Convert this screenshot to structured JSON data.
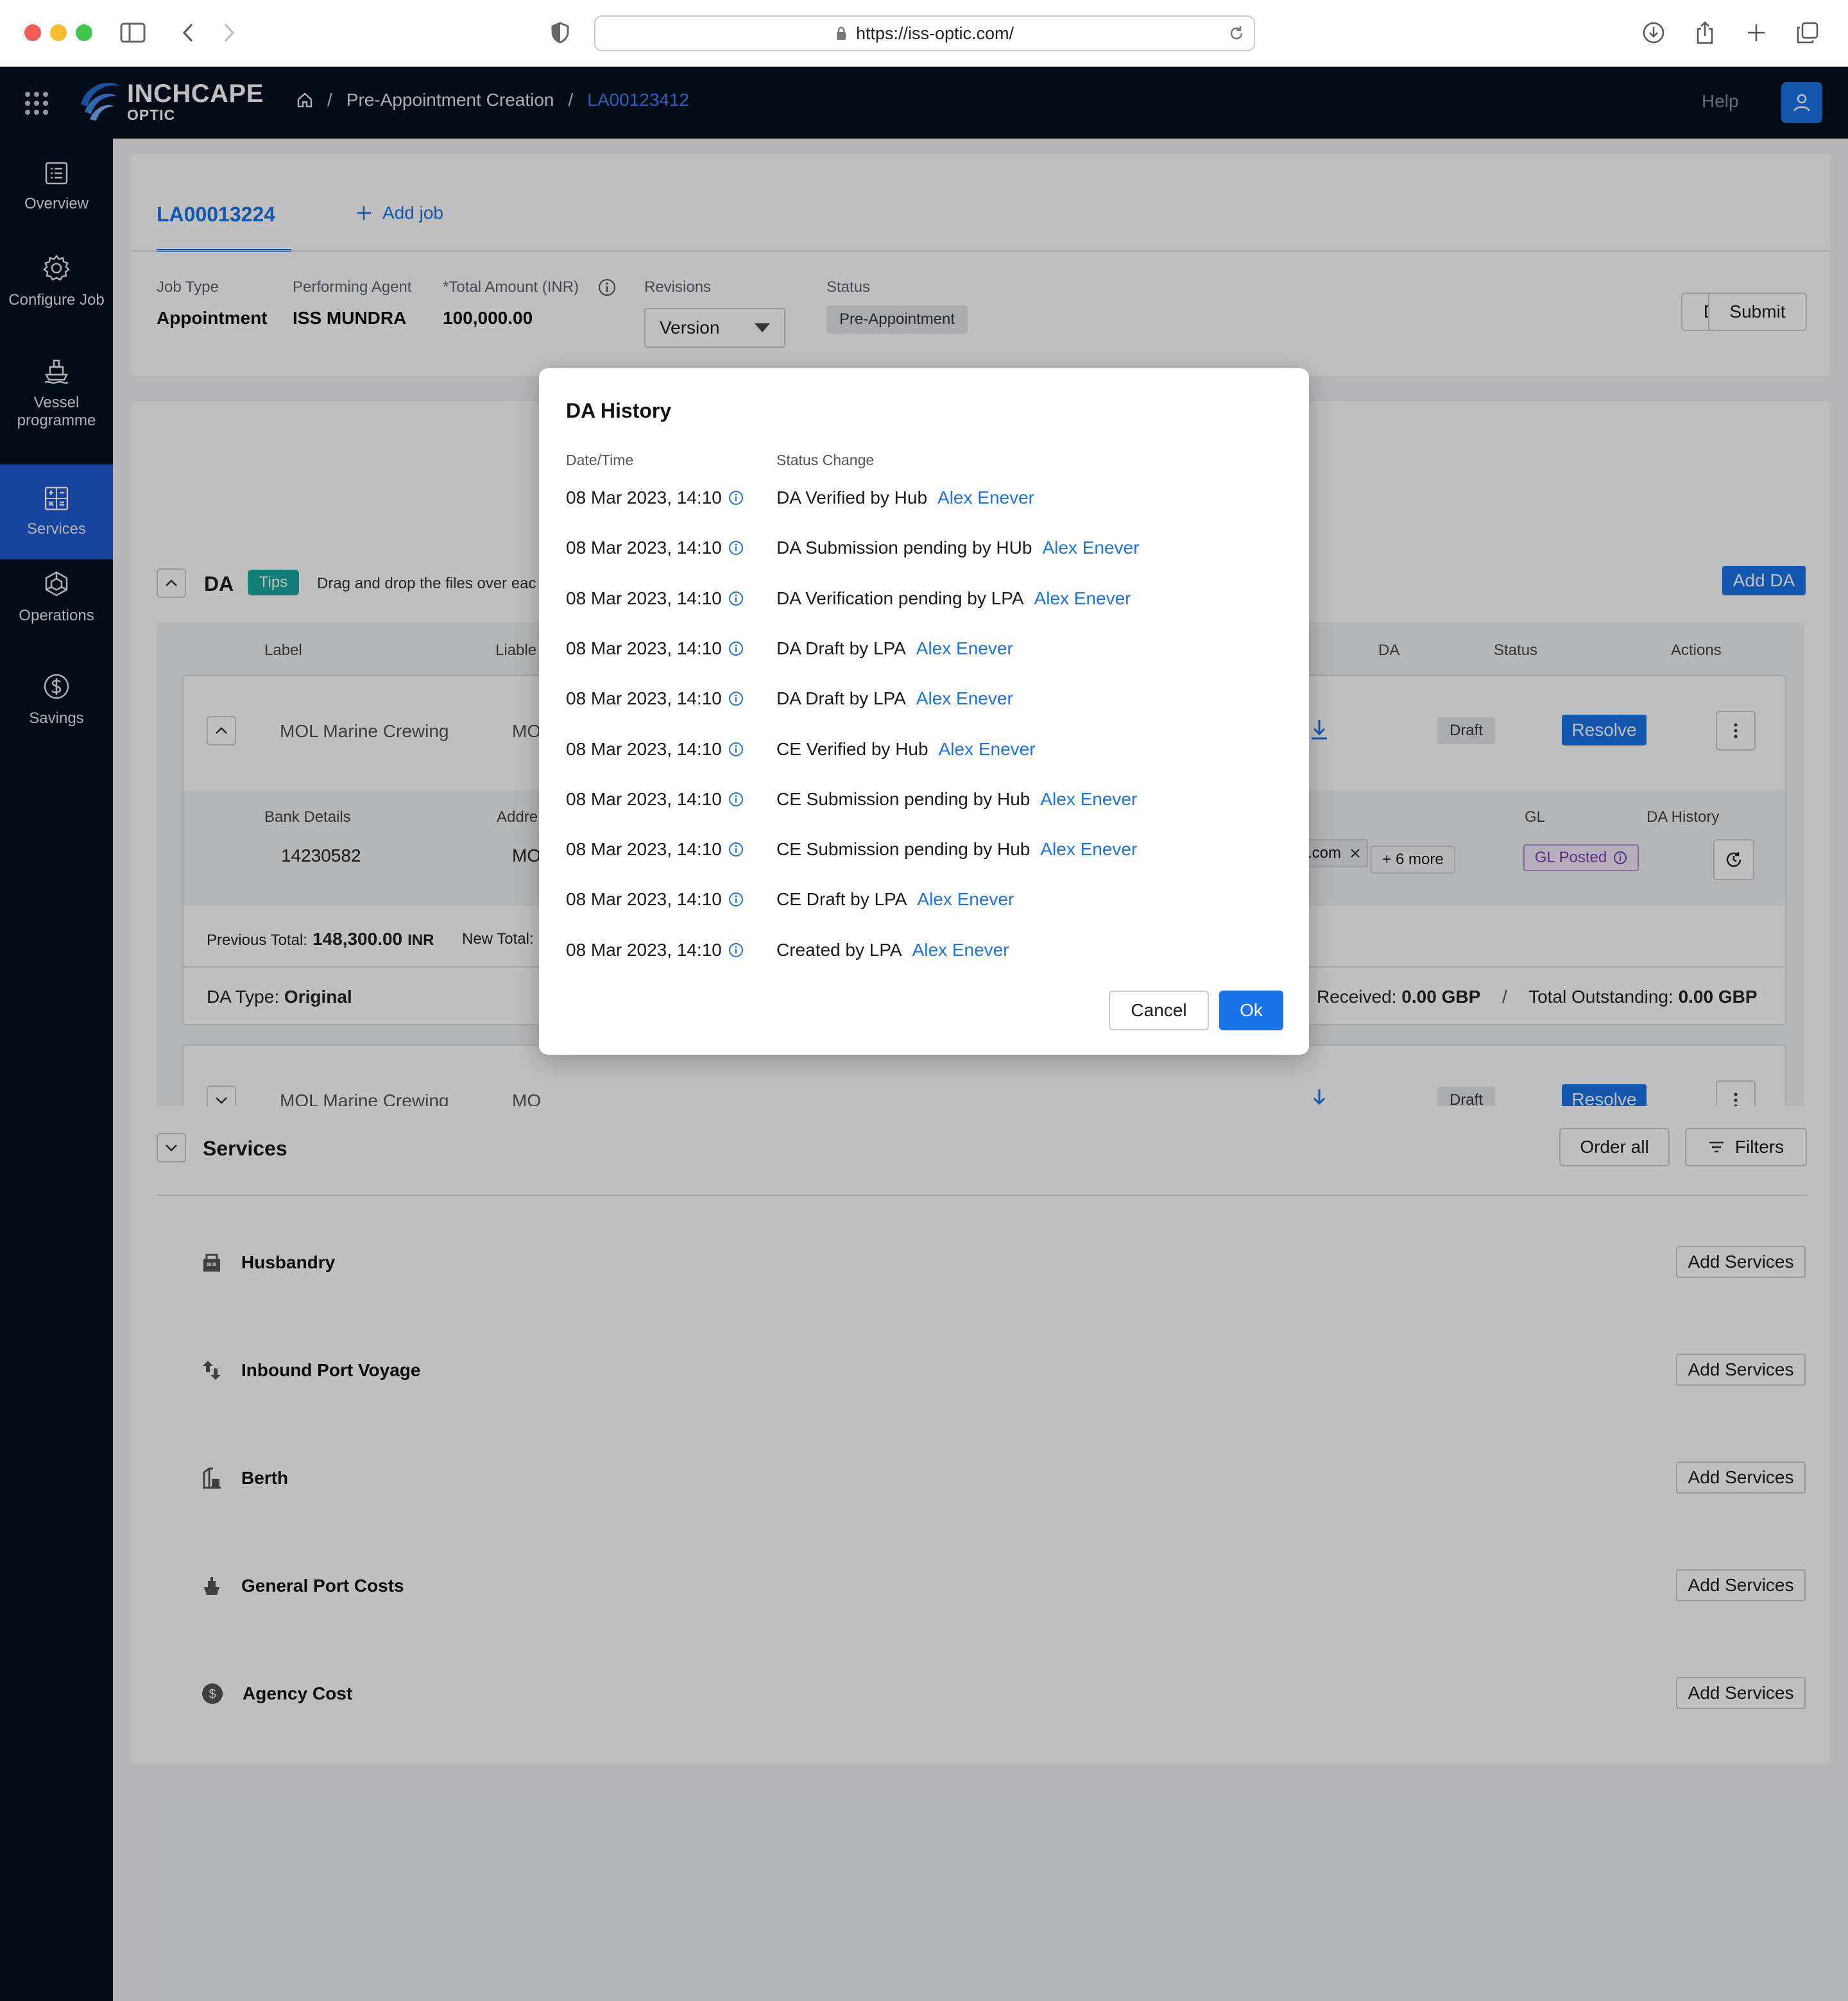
{
  "browser": {
    "url": "https://iss-optic.com/"
  },
  "topbar": {
    "brand_name": "INCHCAPE",
    "brand_sub": "OPTIC",
    "breadcrumb": [
      "Pre-Appointment Creation",
      "LA00123412"
    ],
    "help_label": "Help"
  },
  "sidebar": {
    "items": [
      {
        "label": "Overview",
        "icon": "overview-icon"
      },
      {
        "label": "Configure Job",
        "icon": "gear-icon"
      },
      {
        "label": "Vessel programme",
        "icon": "ship-icon"
      },
      {
        "label": "Services",
        "icon": "calculator-icon",
        "active": true
      },
      {
        "label": "Operations",
        "icon": "operations-icon"
      },
      {
        "label": "Savings",
        "icon": "dollar-icon"
      }
    ]
  },
  "job": {
    "tab_label": "LA00013224",
    "add_job_label": "Add job",
    "fields": {
      "job_type_label": "Job Type",
      "job_type_value": "Appointment",
      "agent_label": "Performing Agent",
      "agent_value": "ISS MUNDRA",
      "amount_label": "*Total Amount (INR)",
      "amount_value": "100,000.00",
      "revisions_label": "Revisions",
      "revisions_value": "Version",
      "status_label": "Status",
      "status_value": "Pre-Appointment"
    },
    "download_label": "Download",
    "submit_label": "Submit"
  },
  "da": {
    "title": "DA",
    "tips_label": "Tips",
    "tips_text": "Drag and drop the files over eac",
    "add_da_label": "Add DA",
    "columns": {
      "label": "Label",
      "liable": "Liable",
      "da": "DA",
      "status": "Status",
      "actions": "Actions"
    },
    "row1": {
      "label": "MOL Marine Crewing",
      "liable": "MO",
      "status": "Draft",
      "resolve_label": "Resolve",
      "bank_details_label": "Bank Details",
      "bank_details_value": "14230582",
      "address_label": "Addre",
      "address_value": "MO",
      "email_tag": ".com",
      "more_label": "+ 6 more",
      "gl_label": "GL",
      "gl_value": "GL Posted",
      "da_history_label": "DA History",
      "previous_total_label": "Previous Total:",
      "previous_total_value": "148,300.00",
      "previous_total_currency": "INR",
      "new_total_label": "New Total:",
      "da_type_label": "DA Type:",
      "da_type_value": "Original",
      "received_label": "Received:",
      "received_value": "0.00 GBP",
      "outstanding_label": "Total Outstanding:",
      "outstanding_value": "0.00 GBP"
    },
    "row2": {
      "label": "MOL Marine Crewing",
      "liable": "MO",
      "status": "Draft",
      "resolve_label": "Resolve"
    }
  },
  "services": {
    "title": "Services",
    "order_all_label": "Order all",
    "filters_label": "Filters",
    "add_services_label": "Add Services",
    "items": [
      {
        "name": "Husbandry",
        "icon": "husbandry-icon"
      },
      {
        "name": "Inbound Port Voyage",
        "icon": "voyage-icon"
      },
      {
        "name": "Berth",
        "icon": "berth-icon"
      },
      {
        "name": "General Port Costs",
        "icon": "port-costs-icon"
      },
      {
        "name": "Agency Cost",
        "icon": "agency-cost-icon"
      }
    ]
  },
  "modal": {
    "title": "DA History",
    "col_datetime": "Date/Time",
    "col_status": "Status Change",
    "rows": [
      {
        "datetime": "08 Mar 2023, 14:10",
        "status": "DA Verified by Hub",
        "user": "Alex Enever"
      },
      {
        "datetime": "08 Mar 2023, 14:10",
        "status": "DA Submission pending by HUb",
        "user": "Alex Enever"
      },
      {
        "datetime": "08 Mar 2023, 14:10",
        "status": "DA Verification pending by LPA",
        "user": "Alex Enever"
      },
      {
        "datetime": "08 Mar 2023, 14:10",
        "status": "DA Draft by LPA",
        "user": "Alex Enever"
      },
      {
        "datetime": "08 Mar 2023, 14:10",
        "status": "DA Draft by LPA",
        "user": "Alex Enever"
      },
      {
        "datetime": "08 Mar 2023, 14:10",
        "status": "CE Verified by Hub",
        "user": "Alex Enever"
      },
      {
        "datetime": "08 Mar 2023, 14:10",
        "status": "CE Submission pending by Hub",
        "user": "Alex Enever"
      },
      {
        "datetime": "08 Mar 2023, 14:10",
        "status": "CE Submission pending by Hub",
        "user": "Alex Enever"
      },
      {
        "datetime": "08 Mar 2023, 14:10",
        "status": "CE Draft by LPA",
        "user": "Alex Enever"
      },
      {
        "datetime": "08 Mar 2023, 14:10",
        "status": "Created by LPA",
        "user": "Alex Enever"
      }
    ],
    "cancel_label": "Cancel",
    "ok_label": "Ok"
  },
  "colors": {
    "primary": "#1a73e8",
    "topbar_bg": "#05101f",
    "sidebar_active": "#1e5bd4",
    "tips_bg": "#1aa7a1",
    "gl_posted": "#7a3fb0"
  }
}
